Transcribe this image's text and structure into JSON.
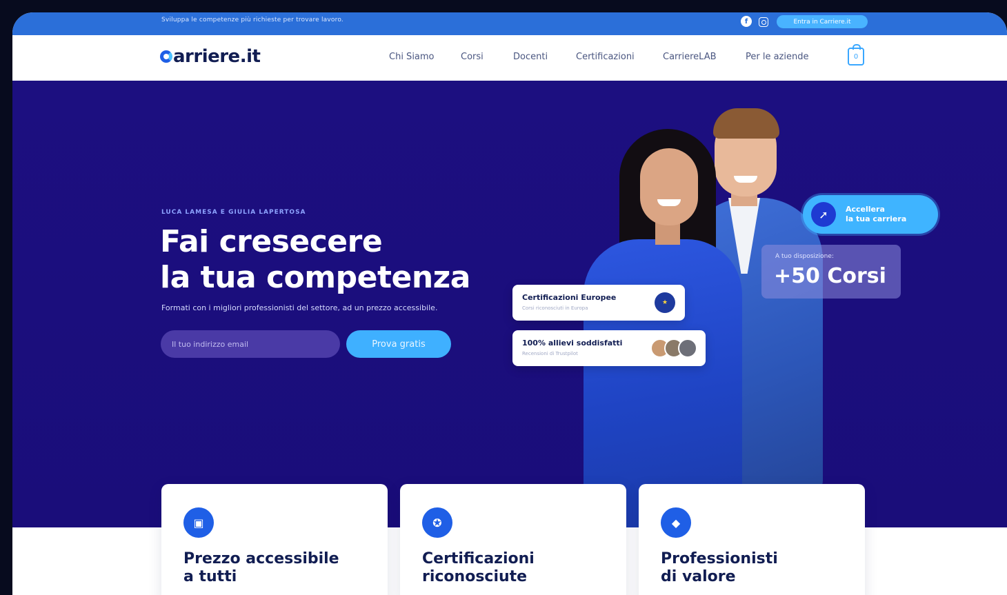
{
  "topbar": {
    "tagline": "Sviluppa le competenze più richieste per trovare lavoro.",
    "social": [
      "facebook-icon",
      "instagram-icon"
    ],
    "cta_label": "Entra in Carriere.it"
  },
  "nav": {
    "logo_text": "arriere.it",
    "links": [
      "Chi Siamo",
      "Corsi",
      "Docenti",
      "Certificazioni",
      "CarriereLAB",
      "Per le aziende"
    ],
    "cart_count": "0"
  },
  "hero": {
    "eyebrow": "LUCA LAMESA E GIULIA LAPERTOSA",
    "headline_line1": "Fai cresecere",
    "headline_line2": "la tua competenza",
    "subline": "Formati con i migliori professionisti del settore, ad un prezzo accessibile.",
    "email_placeholder": "Il tuo indirizzo email",
    "cta_label": "Prova gratis"
  },
  "badges": {
    "accelerate": "Accellera\nla tua carriera",
    "courses_small": "A tuo disposizione:",
    "courses_big": "+50 Corsi"
  },
  "cards": {
    "eu_title": "Certificazioni Europee",
    "eu_sub": "Corsi riconosciuti in Europa",
    "sat_title": "100% allievi soddisfatti",
    "sat_sub": "Recensioni di Trustpilot"
  },
  "features": [
    {
      "title": "Prezzo accessibile\na tutti",
      "icon": "wallet-icon"
    },
    {
      "title": "Certificazioni\nriconosciute",
      "icon": "award-icon"
    },
    {
      "title": "Professionisti\ndi valore",
      "icon": "graduation-icon"
    }
  ],
  "colors": {
    "hero_bg": "#1c0f80",
    "topbar_bg": "#2b6fd9",
    "accent": "#3fb0ff",
    "navy": "#111d52"
  }
}
